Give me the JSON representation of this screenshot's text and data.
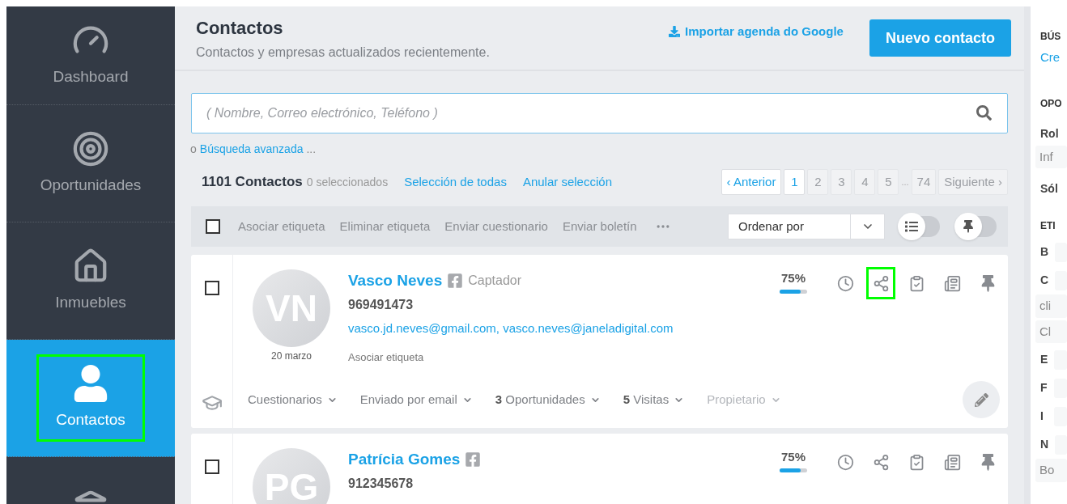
{
  "sidebar": {
    "items": [
      {
        "label": "Dashboard",
        "selected": false,
        "highlighted": false
      },
      {
        "label": "Oportunidades",
        "selected": false,
        "highlighted": false
      },
      {
        "label": "Inmuebles",
        "selected": false,
        "highlighted": false
      },
      {
        "label": "Contactos",
        "selected": true,
        "highlighted": true
      },
      {
        "selected": false,
        "highlighted": false
      }
    ]
  },
  "header": {
    "title": "Contactos",
    "subtitle": "Contactos y empresas actualizados recientemente.",
    "import_link": "Importar agenda do Google",
    "new_button": "Nuevo contacto"
  },
  "search": {
    "placeholder": "( Nombre, Correo electrónico, Teléfono )",
    "advanced_prefix": "o",
    "advanced_link": "Búsqueda avanzada",
    "advanced_suffix": "..."
  },
  "summary": {
    "count": "1101 Contactos",
    "selected_text": "0 seleccionados",
    "select_all": "Selección de todas",
    "clear_selection": "Anular selección"
  },
  "pagination": [
    {
      "label": "‹ Anterior",
      "kind": "nav"
    },
    {
      "label": "1",
      "kind": "page",
      "selected": true
    },
    {
      "label": "2",
      "kind": "page",
      "selected": false
    },
    {
      "label": "3",
      "kind": "page",
      "selected": false
    },
    {
      "label": "4",
      "kind": "page",
      "selected": false
    },
    {
      "label": "5",
      "kind": "page",
      "selected": false
    },
    {
      "label": "...",
      "kind": "gap"
    },
    {
      "label": "74",
      "kind": "page",
      "selected": false
    },
    {
      "label": "Siguiente ›",
      "kind": "next"
    }
  ],
  "toolbar": {
    "checked": false,
    "actions": [
      "Asociar etiqueta",
      "Eliminar etiqueta",
      "Enviar cuestionario",
      "Enviar boletín"
    ],
    "sort": "Ordenar por",
    "list_toggle_on": false,
    "pin_toggle_on": false
  },
  "contacts": [
    {
      "checked": false,
      "initials": "VN",
      "date": "20 marzo",
      "name": "Vasco Neves",
      "role": "Captador",
      "phone": "969491473",
      "emails": "vasco.jd.neves@gmail.com, vasco.neves@janeladigital.com",
      "tag_action": "Asociar etiqueta",
      "completeness": "75%",
      "level": 0.75,
      "actions": [
        {
          "highlighted": false
        },
        {
          "highlighted": true
        },
        {
          "highlighted": false
        },
        {
          "highlighted": false
        },
        {
          "highlighted": false
        }
      ],
      "footer": [
        {
          "label": "Cuestionarios",
          "disabled": false
        },
        {
          "label": "Enviado por email",
          "disabled": false
        },
        {
          "count": "3",
          "label": "Oportunidades",
          "disabled": false
        },
        {
          "count": "5",
          "label": "Visitas",
          "disabled": false
        },
        {
          "label": "Propietario",
          "disabled": true
        }
      ]
    },
    {
      "checked": false,
      "initials": "PG",
      "name": "Patrícia Gomes",
      "phone": "912345678",
      "completeness": "75%",
      "level": 0.75,
      "actions": [
        {
          "highlighted": false
        },
        {
          "highlighted": false
        },
        {
          "highlighted": false
        },
        {
          "highlighted": false
        },
        {
          "highlighted": false
        }
      ]
    }
  ],
  "right_panel": {
    "items": [
      {
        "kind": "heading",
        "text": "BÚS"
      },
      {
        "kind": "link",
        "text": "Cre"
      },
      {
        "kind": "heading",
        "text": "OPO"
      },
      {
        "kind": "label",
        "text": "Rol"
      },
      {
        "kind": "field",
        "text": "Inf"
      },
      {
        "kind": "label",
        "text": "Sól"
      },
      {
        "kind": "heading",
        "text": "ETI"
      },
      {
        "kind": "letter",
        "text": "B"
      },
      {
        "kind": "letter",
        "text": "C"
      },
      {
        "kind": "field",
        "text": "cli"
      },
      {
        "kind": "field",
        "text": "Cl"
      },
      {
        "kind": "letter",
        "text": "E"
      },
      {
        "kind": "letter",
        "text": "F"
      },
      {
        "kind": "letter",
        "text": "I"
      },
      {
        "kind": "letter",
        "text": "N"
      },
      {
        "kind": "field",
        "text": "Bo"
      }
    ]
  }
}
